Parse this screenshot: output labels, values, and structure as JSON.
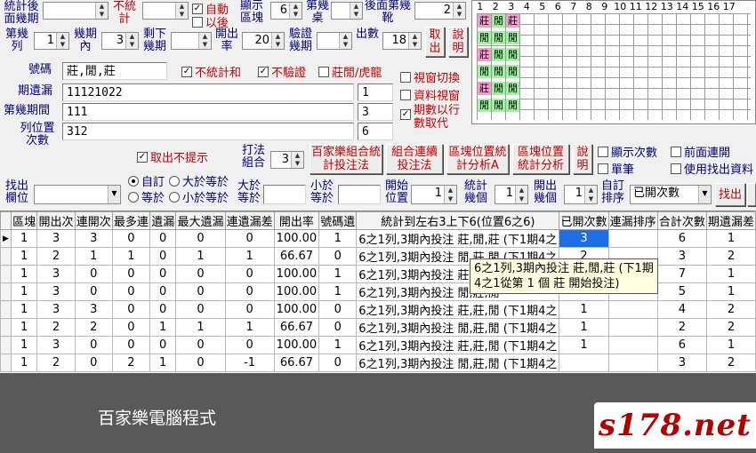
{
  "top": {
    "stat_after_periods_label": "統計後面幾期",
    "no_stat_label": "不統計",
    "auto_label": "自動",
    "after_label": "以後",
    "show_blocks_label": "顯示區塊",
    "show_blocks_value": "6",
    "nth_set_label": "第幾桌",
    "later_nth_table_label": "後面第幾靴",
    "later_nth_table_value": "2"
  },
  "row2": {
    "nth_col_label": "第幾列",
    "nth_col_value": "1",
    "within_periods_label": "幾期內",
    "within_periods_value": "3",
    "remaining_label": "剩下幾期",
    "open_rate_label": "開出率",
    "open_rate_value": "20",
    "verify_periods_label": "驗證幾期",
    "open_count_label": "出數",
    "open_count_value": "18",
    "exit_label": "取出",
    "help_label": "說明"
  },
  "form": {
    "code_label": "號碼",
    "code_value": "莊,閒,莊",
    "no_stat_sum_label": "不統計和",
    "no_verify_label": "不驗證",
    "zhuang_xian_label": "莊閒/虎龍",
    "switch_window_label": "視窗切換",
    "data_window_label": "資料視窗",
    "periods_replace_label": "期數以行數取代",
    "period_missing_label": "期遺漏",
    "period_missing_value": "11121022",
    "period_missing_num": "1",
    "nth_period_label": "第幾期間",
    "nth_period_value": "111",
    "nth_period_num": "3",
    "col_pos_label": "列位置次數",
    "col_pos_value": "312",
    "col_pos_num": "6",
    "hide_prompt_label": "取出不提示",
    "play_combo_label": "打法組合",
    "play_combo_value": "3",
    "baccarat_btn": "百家樂組合統計投注法",
    "combo_btn": "組合連續投注法",
    "block_pos_a_btn": "區塊位置統計分析A",
    "block_pos_btn": "區塊位置統計分析",
    "help2_label": "說明",
    "show_count_label": "顯示次數",
    "single_pen_label": "單筆",
    "prev_link_label": "前面連開",
    "use_find_label": "使用找出資料"
  },
  "row5": {
    "find_col_label": "找出欄位",
    "custom_label": "自訂",
    "ge_label": "大於等於",
    "eq_label": "等於",
    "le_label": "小於等於",
    "gt_eq_label": "大於等於",
    "lt_eq_label": "小於等於",
    "start_pos_label": "開始位置",
    "start_pos_value": "1",
    "stat_count_label": "統計幾個",
    "stat_count_value": "1",
    "open_periods_label": "開出幾個",
    "open_periods_value": "1",
    "custom_sort_label": "自訂排序",
    "sort_select": "已開次數",
    "find_button": "找出"
  },
  "grid": {
    "headers": [
      "1",
      "2",
      "3",
      "4",
      "5",
      "6",
      "7",
      "8",
      "9",
      "10",
      "11",
      "12",
      "13",
      "14",
      "15",
      "16",
      "17"
    ],
    "cells": [
      [
        "莊",
        "閒",
        "莊"
      ],
      [
        "閒",
        "閒",
        "閒"
      ],
      [
        "莊",
        "閒",
        "閒"
      ],
      [
        "閒",
        "閒",
        "閒"
      ],
      [
        "莊",
        "閒",
        "閒"
      ],
      [
        "閒",
        "閒",
        "閒"
      ]
    ]
  },
  "table": {
    "columns": [
      "區塊",
      "開出次",
      "連開次",
      "最多連",
      "遺漏",
      "最大遺漏",
      "連遺漏差",
      "開出率",
      "號碼遺",
      "統計到左右3上下6(位置6之6)",
      "已開次數",
      "連漏排序",
      "合計次數",
      "期遺漏差"
    ],
    "rows": [
      [
        "1",
        "3",
        "3",
        "0",
        "0",
        "0",
        "0",
        "100.00",
        "1",
        "6之1列,3期內投注 莊,閒,莊 (下1期4之",
        "3",
        "",
        "6",
        "1"
      ],
      [
        "1",
        "2",
        "1",
        "1",
        "0",
        "1",
        "1",
        "66.67",
        "0",
        "6之1列,3期內投注 閒,莊,閒 (下1期4之",
        "2",
        "",
        "3",
        "2"
      ],
      [
        "1",
        "3",
        "0",
        "0",
        "0",
        "0",
        "0",
        "100.00",
        "1",
        "6之1列,3期內投注 莊,閒,莊",
        "",
        "",
        "7",
        "1"
      ],
      [
        "1",
        "3",
        "0",
        "0",
        "0",
        "0",
        "0",
        "100.00",
        "1",
        "6之1列,3期內投注 閒,莊,閒",
        "",
        "",
        "5",
        "1"
      ],
      [
        "1",
        "3",
        "3",
        "0",
        "0",
        "0",
        "0",
        "100.00",
        "0",
        "6之1列,3期內投注 莊,莊,閒 (下1期4之",
        "1",
        "",
        "4",
        "2"
      ],
      [
        "1",
        "2",
        "2",
        "0",
        "1",
        "1",
        "1",
        "66.67",
        "0",
        "6之1列,3期內投注 閒,莊,閒 (下1期4之",
        "1",
        "",
        "2",
        "2"
      ],
      [
        "1",
        "3",
        "0",
        "0",
        "0",
        "0",
        "0",
        "100.00",
        "1",
        "6之1列,3期內投注 莊,莊,閒 (下1期4之",
        "1",
        "",
        "6",
        "1"
      ],
      [
        "1",
        "2",
        "0",
        "2",
        "1",
        "0",
        "-1",
        "66.67",
        "0",
        "6之1列,3期內投注 閒,莊,閒 (下1期4之",
        "",
        "",
        "3",
        "2"
      ]
    ],
    "tooltip": "6之1列,3期內投注 莊,閒,莊 (下1期4之1從第 1 個 莊 開始投注)"
  },
  "footer": {
    "caption": "百家樂電腦程式",
    "brand": "s178.net"
  }
}
